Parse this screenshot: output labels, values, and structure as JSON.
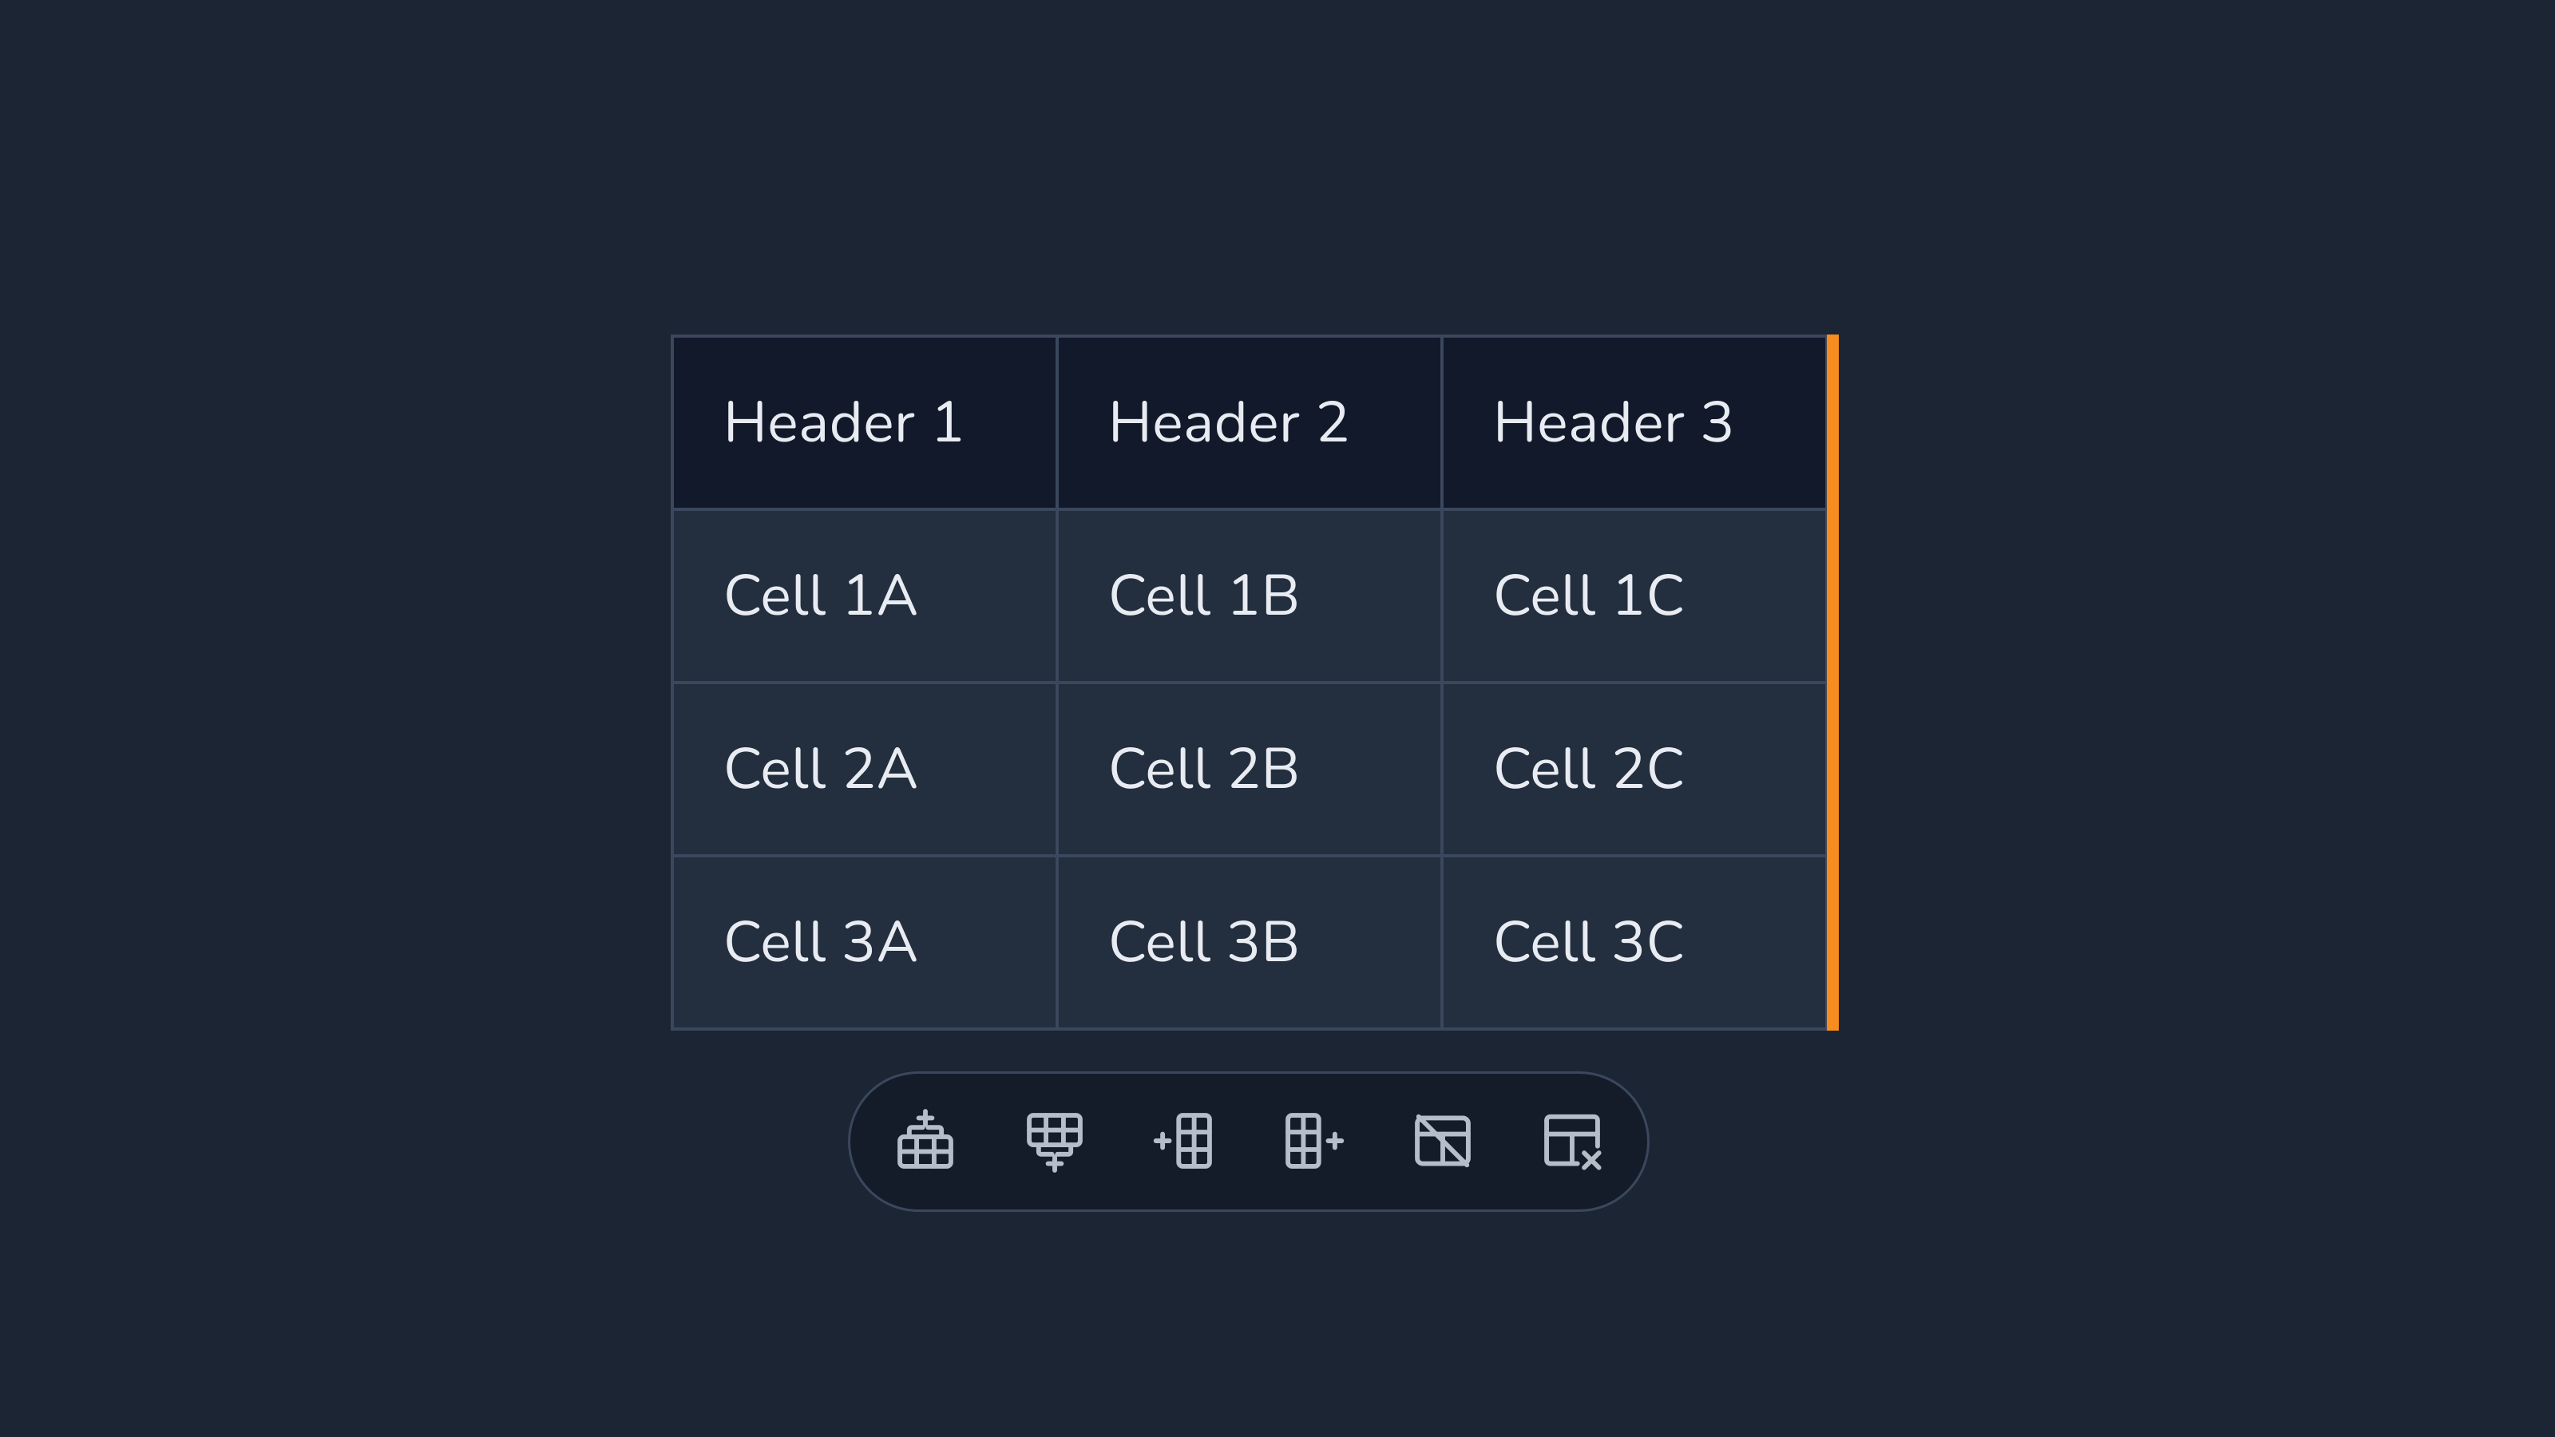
{
  "table": {
    "headers": [
      "Header 1",
      "Header 2",
      "Header 3"
    ],
    "rows": [
      [
        "Cell 1A",
        "Cell 1B",
        "Cell 1C"
      ],
      [
        "Cell 2A",
        "Cell 2B",
        "Cell 2C"
      ],
      [
        "Cell 3A",
        "Cell 3B",
        "Cell 3C"
      ]
    ],
    "selected_column_index": 2
  },
  "toolbar": {
    "items": [
      {
        "name": "insert-row-above-icon"
      },
      {
        "name": "insert-row-below-icon"
      },
      {
        "name": "insert-column-left-icon"
      },
      {
        "name": "insert-column-right-icon"
      },
      {
        "name": "toggle-header-hidden-icon"
      },
      {
        "name": "delete-table-icon"
      }
    ]
  },
  "colors": {
    "accent": "#f78c1f",
    "bg": "#1b2533",
    "cell_bg": "#232e3e",
    "header_bg": "#12192a",
    "border": "#3a475c"
  }
}
